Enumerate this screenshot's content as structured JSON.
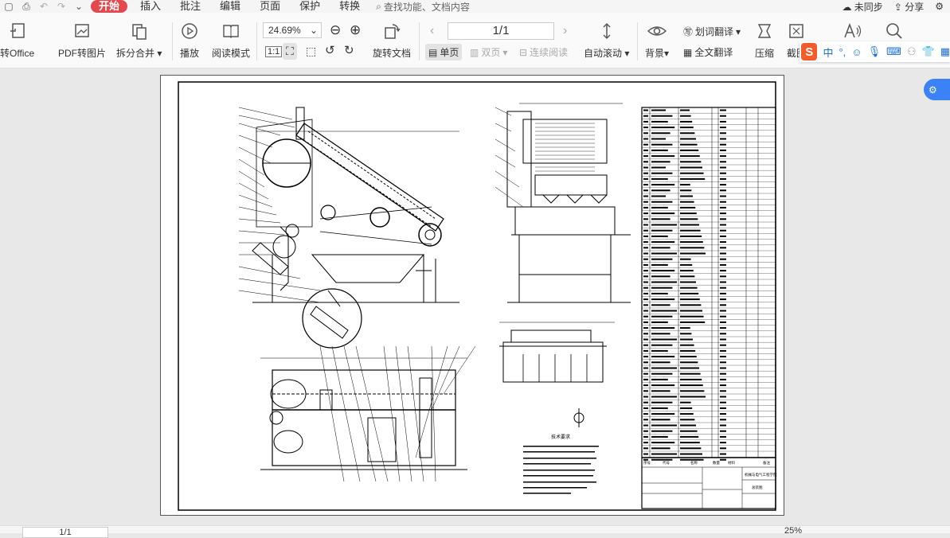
{
  "menubar": {
    "tabs": [
      "开始",
      "插入",
      "批注",
      "编辑",
      "页面",
      "保护",
      "转换"
    ],
    "active_tab": "开始",
    "search_placeholder": "查找功能、文档内容",
    "sync_label": "未同步",
    "share_label": "分享"
  },
  "ribbon": {
    "to_office": "转Office",
    "pdf_to_image": "PDF转图片",
    "split_merge": "拆分合并",
    "play": "播放",
    "read_mode": "阅读模式",
    "zoom_value": "24.69%",
    "rotate_doc": "旋转文档",
    "page_indicator": "1/1",
    "single_page": "单页",
    "double_page": "双页",
    "continuous": "连续阅读",
    "auto_scroll": "自动滚动",
    "background": "背景",
    "word_translate": "划词翻译",
    "full_translate": "全文翻译",
    "compress": "压缩",
    "screenshot": "截图"
  },
  "ime": {
    "logo": "S",
    "mode": "中"
  },
  "document": {
    "notes_title": "技术要求",
    "table_footer": {
      "col_no": "序号",
      "col_code": "代号",
      "col_name": "名称",
      "col_qty": "数量",
      "col_material": "材料",
      "col_remark": "备注",
      "drawing_title": "总装图",
      "company": "机械与电气工程学院"
    }
  },
  "statusbar": {
    "page": "1/1",
    "zoom": "25%"
  },
  "colors": {
    "accent": "#e5484d",
    "brand_blue": "#3b82f6",
    "ime_orange": "#f25c2b"
  }
}
